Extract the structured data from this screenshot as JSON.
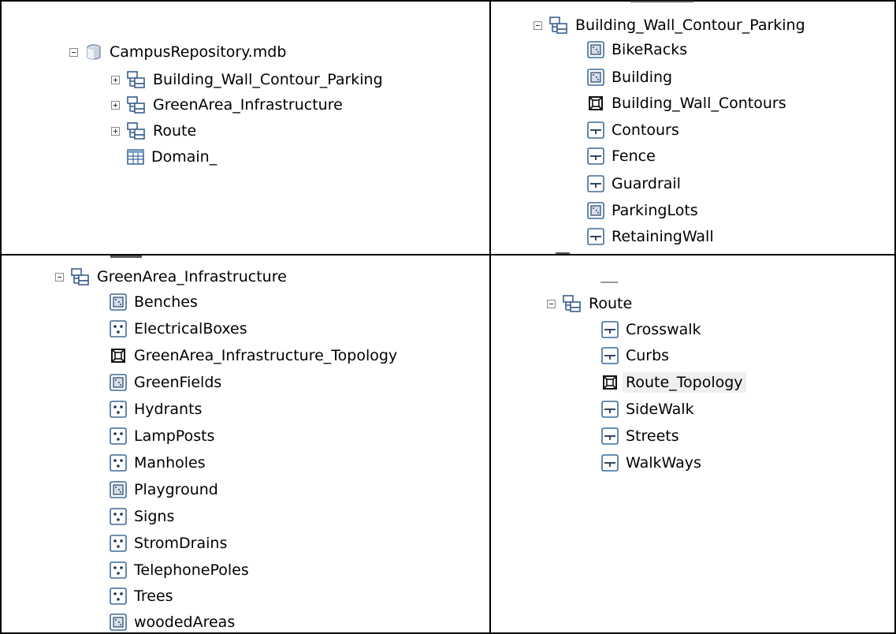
{
  "top_left": {
    "root": {
      "label": "CampusRepository.mdb",
      "icon": "database-icon"
    },
    "children": [
      {
        "label": "Building_Wall_Contour_Parking",
        "icon": "feature-dataset-icon",
        "toggle": "plus"
      },
      {
        "label": "GreenArea_Infrastructure",
        "icon": "feature-dataset-icon",
        "toggle": "plus"
      },
      {
        "label": "Route",
        "icon": "feature-dataset-icon",
        "toggle": "plus"
      },
      {
        "label": "Domain_",
        "icon": "table-icon"
      }
    ]
  },
  "top_right": {
    "root": {
      "label": "Building_Wall_Contour_Parking",
      "icon": "feature-dataset-icon"
    },
    "children": [
      {
        "label": "BikeRacks",
        "icon": "polygon-icon"
      },
      {
        "label": "Building",
        "icon": "polygon-icon"
      },
      {
        "label": "Building_Wall_Contours",
        "icon": "topology-icon"
      },
      {
        "label": "Contours",
        "icon": "line-icon"
      },
      {
        "label": "Fence",
        "icon": "line-icon"
      },
      {
        "label": "Guardrail",
        "icon": "line-icon"
      },
      {
        "label": "ParkingLots",
        "icon": "polygon-icon"
      },
      {
        "label": "RetainingWall",
        "icon": "line-icon"
      }
    ]
  },
  "bottom_left": {
    "root": {
      "label": "GreenArea_Infrastructure",
      "icon": "feature-dataset-icon"
    },
    "children": [
      {
        "label": "Benches",
        "icon": "polygon-icon"
      },
      {
        "label": "ElectricalBoxes",
        "icon": "point-icon"
      },
      {
        "label": "GreenArea_Infrastructure_Topology",
        "icon": "topology-icon"
      },
      {
        "label": "GreenFields",
        "icon": "polygon-icon"
      },
      {
        "label": "Hydrants",
        "icon": "point-icon"
      },
      {
        "label": "LampPosts",
        "icon": "point-icon"
      },
      {
        "label": "Manholes",
        "icon": "point-icon"
      },
      {
        "label": "Playground",
        "icon": "polygon-icon"
      },
      {
        "label": "Signs",
        "icon": "point-icon"
      },
      {
        "label": "StromDrains",
        "icon": "point-icon"
      },
      {
        "label": "TelephonePoles",
        "icon": "point-icon"
      },
      {
        "label": "Trees",
        "icon": "point-icon"
      },
      {
        "label": "woodedAreas",
        "icon": "polygon-icon"
      }
    ]
  },
  "bottom_right": {
    "root": {
      "label": "Route",
      "icon": "feature-dataset-icon"
    },
    "children": [
      {
        "label": "Crosswalk",
        "icon": "line-icon"
      },
      {
        "label": "Curbs",
        "icon": "line-icon"
      },
      {
        "label": "Route_Topology",
        "icon": "topology-icon",
        "selected": true
      },
      {
        "label": "SideWalk",
        "icon": "line-icon"
      },
      {
        "label": "Streets",
        "icon": "line-icon"
      },
      {
        "label": "WalkWays",
        "icon": "line-icon"
      }
    ]
  }
}
